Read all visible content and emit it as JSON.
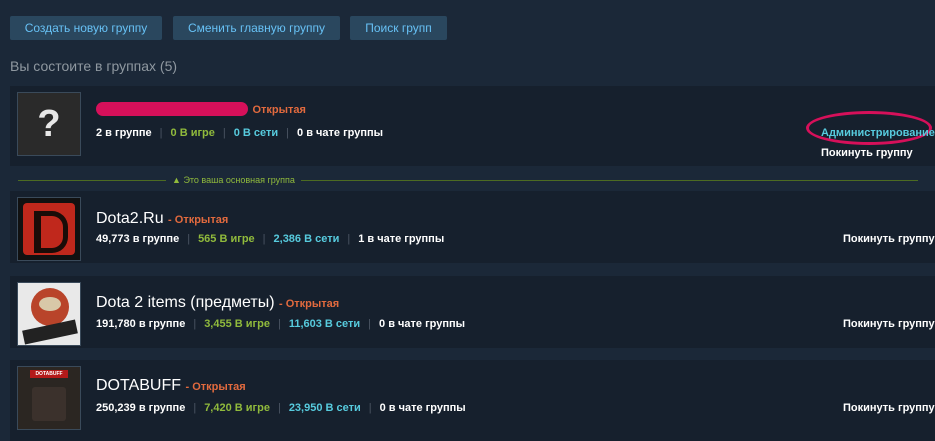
{
  "toolbar": {
    "create_label": "Создать новую группу",
    "change_label": "Сменить главную группу",
    "search_label": "Поиск групп"
  },
  "section_title": "Вы состоите в группах (5)",
  "primary_label": "Это ваша основная группа",
  "groups": [
    {
      "name": "",
      "status": "Открытая",
      "members": "2 в группе",
      "ingame": "0 В игре",
      "online": "0 В сети",
      "chat": "0 в чате группы",
      "admin": "Администрирование",
      "leave": "Покинуть группу"
    },
    {
      "name": "Dota2.Ru",
      "status": "- Открытая",
      "members": "49,773 в группе",
      "ingame": "565 В игре",
      "online": "2,386 В сети",
      "chat": "1 в чате группы",
      "leave": "Покинуть группу"
    },
    {
      "name": "Dota 2 items (предметы)",
      "status": "- Открытая",
      "members": "191,780 в группе",
      "ingame": "3,455 В игре",
      "online": "11,603 В сети",
      "chat": "0 в чате группы",
      "leave": "Покинуть группу"
    },
    {
      "name": "DOTABUFF",
      "status": "- Открытая",
      "members": "250,239 в группе",
      "ingame": "7,420 В игре",
      "online": "23,950 В сети",
      "chat": "0 в чате группы",
      "leave": "Покинуть группу",
      "logo_text": "DOTABUFF"
    }
  ],
  "colors": {
    "background": "#1b2838",
    "row": "#16202d",
    "open": "#e26a3e",
    "ingame": "#90ba3c",
    "online": "#57cbde",
    "highlight": "#d6105a"
  }
}
